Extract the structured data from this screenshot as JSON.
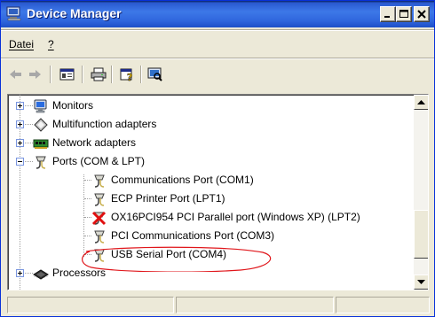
{
  "window": {
    "title": "Device Manager",
    "title_icon": "device-manager-icon"
  },
  "menu": {
    "items": [
      "Datei",
      "?"
    ]
  },
  "toolbar": {
    "buttons": [
      "back-arrow-icon",
      "forward-arrow-icon",
      "properties-icon",
      "print-icon",
      "help-icon",
      "scan-hardware-icon"
    ]
  },
  "tree": {
    "nodes": [
      {
        "label": "Monitors",
        "icon": "monitor-icon",
        "expander": "+"
      },
      {
        "label": "Multifunction adapters",
        "icon": "multifunction-adapter-icon",
        "expander": "+"
      },
      {
        "label": "Network adapters",
        "icon": "network-adapter-icon",
        "expander": "+"
      },
      {
        "label": "Ports (COM & LPT)",
        "icon": "port-connector-icon",
        "expander": "-"
      },
      {
        "label": "Communications Port (COM1)",
        "icon": "port-connector-icon"
      },
      {
        "label": "ECP Printer Port (LPT1)",
        "icon": "port-connector-icon"
      },
      {
        "label": "OX16PCI954 PCI Parallel port (Windows XP) (LPT2)",
        "icon": "disabled-port-icon"
      },
      {
        "label": "PCI Communications Port (COM3)",
        "icon": "port-connector-icon"
      },
      {
        "label": "USB Serial Port (COM4)",
        "icon": "port-connector-icon"
      },
      {
        "label": "Processors",
        "icon": "processor-icon",
        "expander": "+"
      }
    ],
    "highlight_color": "#e0161b"
  },
  "colors": {
    "titlebar": "#2f66dd",
    "chrome": "#ece9d8",
    "highlight": "#e0161b"
  }
}
